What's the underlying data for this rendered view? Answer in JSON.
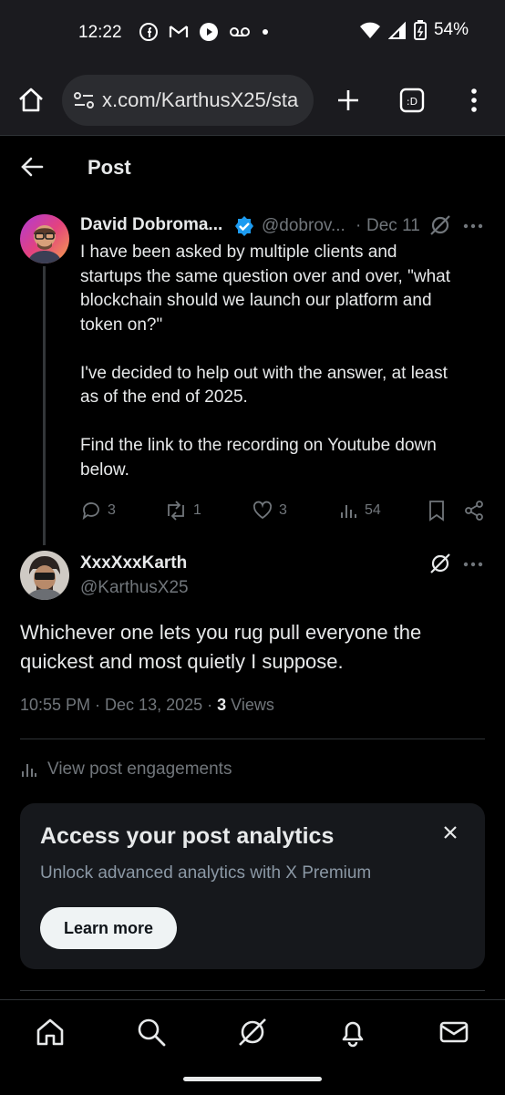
{
  "status_bar": {
    "time": "12:22",
    "battery": "54%"
  },
  "browser": {
    "url": "x.com/KarthusX25/sta"
  },
  "header": {
    "title": "Post"
  },
  "parent_post": {
    "author_name": "David Dobroma...",
    "handle": "@dobrov...",
    "separator": "·",
    "date": "Dec 11",
    "text_lines": [
      "I have been asked by multiple clients and",
      "startups the same question over and over, \"what",
      "blockchain should we launch our platform and",
      "token on?\"",
      "",
      "I've decided to help out with the answer, at least",
      "as of the end of 2025.",
      "",
      "Find the  link to the recording on Youtube down",
      "below."
    ],
    "stats": {
      "replies": "3",
      "reposts": "1",
      "likes": "3",
      "views": "54"
    }
  },
  "reply_post": {
    "author_name": "XxxXxxKarth",
    "handle": "@KarthusX25",
    "text_lines": [
      "Whichever one lets you rug pull everyone the",
      "quickest and most quietly I suppose."
    ],
    "timestamp": "10:55 PM · Dec 13, 2025 · ",
    "views_count": "3",
    "views_label": " Views"
  },
  "engagements": {
    "label": "View post engagements"
  },
  "analytics_card": {
    "title": "Access your post analytics",
    "subtitle": "Unlock advanced analytics with X Premium",
    "button_label": "Learn more"
  },
  "colors": {
    "background": "#000000",
    "verified": "#1d9bf0",
    "muted": "#71767b"
  }
}
